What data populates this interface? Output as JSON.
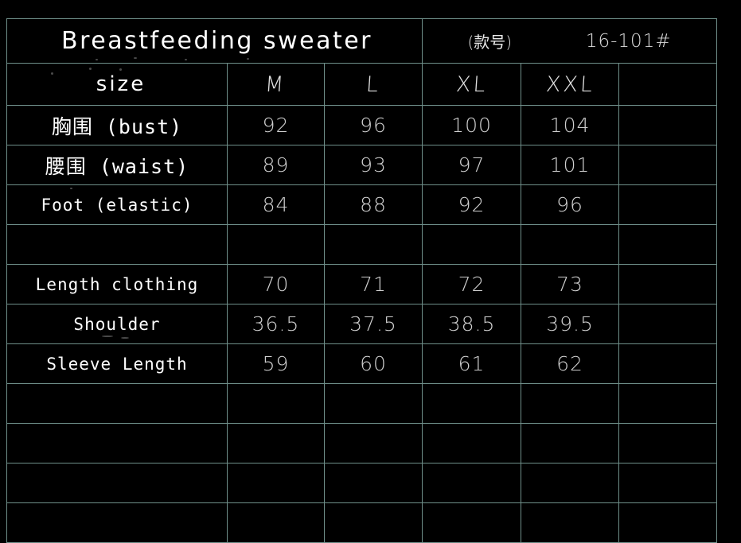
{
  "header": {
    "title": "Breastfeeding sweater",
    "style_no_label": "(款号)",
    "style_no_value": "16-101#"
  },
  "table": {
    "size_row_label": "size",
    "sizes": [
      "M",
      "L",
      "XL",
      "XXL"
    ],
    "rows": [
      {
        "label": "胸围 (bust)",
        "values": [
          "92",
          "96",
          "100",
          "104"
        ]
      },
      {
        "label": "腰围 (waist)",
        "values": [
          "89",
          "93",
          "97",
          "101"
        ]
      },
      {
        "label": "Foot (elastic)",
        "values": [
          "84",
          "88",
          "92",
          "96"
        ]
      },
      {
        "label": "",
        "values": [
          "",
          "",
          "",
          ""
        ]
      },
      {
        "label": "Length clothing",
        "values": [
          "70",
          "71",
          "72",
          "73"
        ]
      },
      {
        "label": "Shoulder",
        "values": [
          "36.5",
          "37.5",
          "38.5",
          "39.5"
        ]
      },
      {
        "label": "Sleeve Length",
        "values": [
          "59",
          "60",
          "61",
          "62"
        ]
      },
      {
        "label": "",
        "values": [
          "",
          "",
          "",
          ""
        ]
      },
      {
        "label": "",
        "values": [
          "",
          "",
          "",
          ""
        ]
      },
      {
        "label": "",
        "values": [
          "",
          "",
          "",
          ""
        ]
      },
      {
        "label": "",
        "values": [
          "",
          "",
          "",
          ""
        ]
      }
    ]
  },
  "colors": {
    "background": "#000000",
    "grid_line": "#6f8f8a",
    "label_text": "#ffffff",
    "value_text": "#cfcfcf"
  }
}
